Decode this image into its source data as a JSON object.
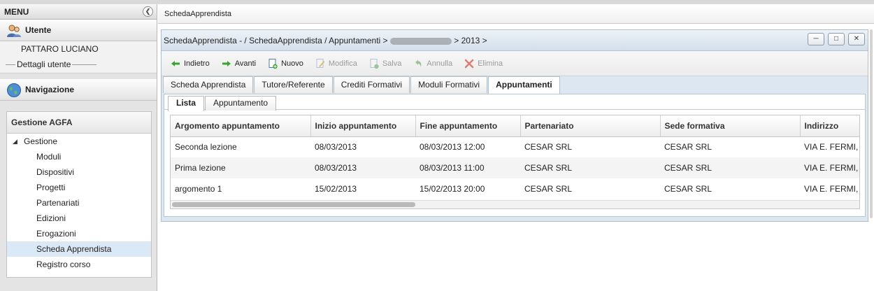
{
  "menu": {
    "title": "MENU",
    "collapse_icon": "chevron-left-icon",
    "user_section": {
      "title": "Utente",
      "name": "PATTARO LUCIANO",
      "details_label": "Dettagli utente"
    },
    "nav_section": {
      "title": "Navigazione"
    },
    "panel": {
      "title": "Gestione AGFA",
      "root": "Gestione",
      "items": [
        "Moduli",
        "Dispositivi",
        "Progetti",
        "Partenariati",
        "Edizioni",
        "Erogazioni",
        "Scheda Apprendista",
        "Registro corso"
      ],
      "selected": "Scheda Apprendista"
    }
  },
  "main_tab": {
    "label": "SchedaApprendista"
  },
  "window": {
    "title_prefix": "SchedaApprendista - / SchedaApprendista / Appuntamenti >",
    "title_suffix": "> 2013 >",
    "controls": [
      "minimize-icon",
      "maximize-icon",
      "close-icon"
    ]
  },
  "toolbar": {
    "back": "Indietro",
    "forward": "Avanti",
    "new": "Nuovo",
    "edit": "Modifica",
    "save": "Salva",
    "cancel": "Annulla",
    "delete": "Elimina"
  },
  "tabs": [
    "Scheda Apprendista",
    "Tutore/Referente",
    "Crediti Formativi",
    "Moduli Formativi",
    "Appuntamenti"
  ],
  "active_tab": "Appuntamenti",
  "subtabs": [
    "Lista",
    "Appuntamento"
  ],
  "active_subtab": "Lista",
  "grid": {
    "columns": [
      "Argomento appuntamento",
      "Inizio appuntamento",
      "Fine appuntamento",
      "Partenariato",
      "Sede formativa",
      "Indirizzo"
    ],
    "rows": [
      [
        "Seconda lezione",
        "08/03/2013",
        "08/03/2013 12:00",
        "CESAR SRL",
        "CESAR SRL",
        "VIA E. FERMI,"
      ],
      [
        "Prima lezione",
        "08/03/2013",
        "08/03/2013 11:00",
        "CESAR SRL",
        "CESAR SRL",
        "VIA E. FERMI,"
      ],
      [
        "argomento 1",
        "15/02/2013",
        "15/02/2013 20:00",
        "CESAR SRL",
        "CESAR SRL",
        "VIA E. FERMI,"
      ]
    ]
  },
  "colors": {
    "window_bg": "#dce7f1",
    "selected_row": "#dbe9f7",
    "delete_red": "#d9534f",
    "arrow_green": "#3aa52b"
  }
}
